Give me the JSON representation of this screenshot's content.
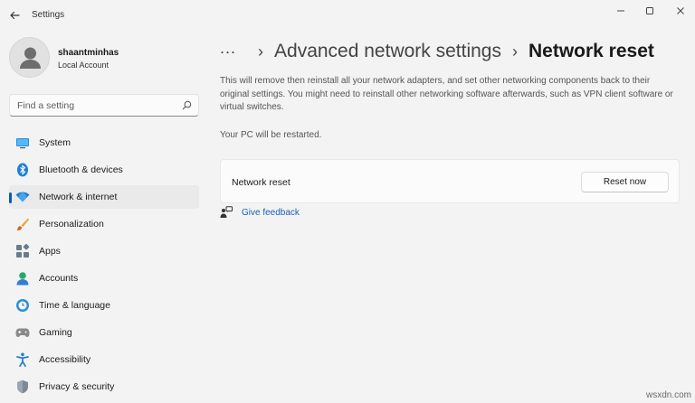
{
  "window": {
    "app_title": "Settings",
    "controls": [
      {
        "name": "minimize",
        "glyph": "—"
      },
      {
        "name": "maximize",
        "glyph": "☐"
      },
      {
        "name": "close",
        "glyph": "✕"
      }
    ]
  },
  "profile": {
    "username": "shaantminhas",
    "account_type": "Local Account"
  },
  "search": {
    "placeholder": "Find a setting",
    "value": "",
    "icon": "search-icon"
  },
  "sidebar": {
    "items": [
      {
        "label": "System",
        "icon": "system-icon",
        "active": false
      },
      {
        "label": "Bluetooth & devices",
        "icon": "bluetooth-icon",
        "active": false
      },
      {
        "label": "Network & internet",
        "icon": "wifi-icon",
        "active": true
      },
      {
        "label": "Personalization",
        "icon": "brush-icon",
        "active": false
      },
      {
        "label": "Apps",
        "icon": "apps-icon",
        "active": false
      },
      {
        "label": "Accounts",
        "icon": "person-icon",
        "active": false
      },
      {
        "label": "Time & language",
        "icon": "globe-clock-icon",
        "active": false
      },
      {
        "label": "Gaming",
        "icon": "gamepad-icon",
        "active": false
      },
      {
        "label": "Accessibility",
        "icon": "accessibility-icon",
        "active": false
      },
      {
        "label": "Privacy & security",
        "icon": "shield-icon",
        "active": false
      }
    ]
  },
  "breadcrumb": {
    "more": "...",
    "separator": "›",
    "parent": "Advanced network settings",
    "current": "Network reset"
  },
  "main": {
    "description": "This will remove then reinstall all your network adapters, and set other networking components back to their original settings. You might need to reinstall other networking software afterwards, such as VPN client software or virtual switches.",
    "restart_note": "Your PC will be restarted.",
    "card": {
      "label": "Network reset",
      "button_label": "Reset now"
    },
    "feedback_label": "Give feedback"
  },
  "watermark": "wsxdn.com",
  "colors": {
    "accent": "#005fb8",
    "background": "#f3f3f3",
    "card": "#fbfbfb",
    "link": "#1a5fb4"
  }
}
